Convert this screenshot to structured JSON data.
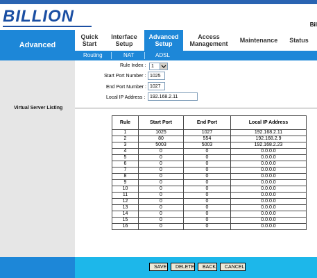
{
  "brand": {
    "logo": "BILLION",
    "right_text": "Bil"
  },
  "nav": {
    "section": "Advanced",
    "items": [
      {
        "label": "Quick Start"
      },
      {
        "label": "Interface Setup"
      },
      {
        "label": "Advanced Setup"
      },
      {
        "label": "Access Management"
      },
      {
        "label": "Maintenance"
      },
      {
        "label": "Status"
      }
    ],
    "subitems": [
      "Routing",
      "NAT",
      "ADSL"
    ]
  },
  "form": {
    "rule_index_label": "Rule Index :",
    "rule_index_value": "1",
    "start_port_label": "Start Port Number :",
    "start_port_value": "1025",
    "end_port_label": "End Port Number :",
    "end_port_value": "1027",
    "local_ip_label": "Local IP Address :",
    "local_ip_value": "192.168.2.11"
  },
  "listing": {
    "title": "Virtual Server Listing",
    "headers": [
      "Rule",
      "Start Port",
      "End Port",
      "Local IP Address"
    ],
    "rows": [
      [
        "1",
        "1025",
        "1027",
        "192.168.2.11"
      ],
      [
        "2",
        "80",
        "554",
        "192.168.2.9"
      ],
      [
        "3",
        "5003",
        "5003",
        "192.168.2.23"
      ],
      [
        "4",
        "0",
        "0",
        "0.0.0.0"
      ],
      [
        "5",
        "0",
        "0",
        "0.0.0.0"
      ],
      [
        "6",
        "0",
        "0",
        "0.0.0.0"
      ],
      [
        "7",
        "0",
        "0",
        "0.0.0.0"
      ],
      [
        "8",
        "0",
        "0",
        "0.0.0.0"
      ],
      [
        "9",
        "0",
        "0",
        "0.0.0.0"
      ],
      [
        "10",
        "0",
        "0",
        "0.0.0.0"
      ],
      [
        "11",
        "0",
        "0",
        "0.0.0.0"
      ],
      [
        "12",
        "0",
        "0",
        "0.0.0.0"
      ],
      [
        "13",
        "0",
        "0",
        "0.0.0.0"
      ],
      [
        "14",
        "0",
        "0",
        "0.0.0.0"
      ],
      [
        "15",
        "0",
        "0",
        "0.0.0.0"
      ],
      [
        "16",
        "0",
        "0",
        "0.0.0.0"
      ]
    ]
  },
  "buttons": {
    "save": "SAVE",
    "delete": "DELETE",
    "back": "BACK",
    "cancel": "CANCEL"
  }
}
